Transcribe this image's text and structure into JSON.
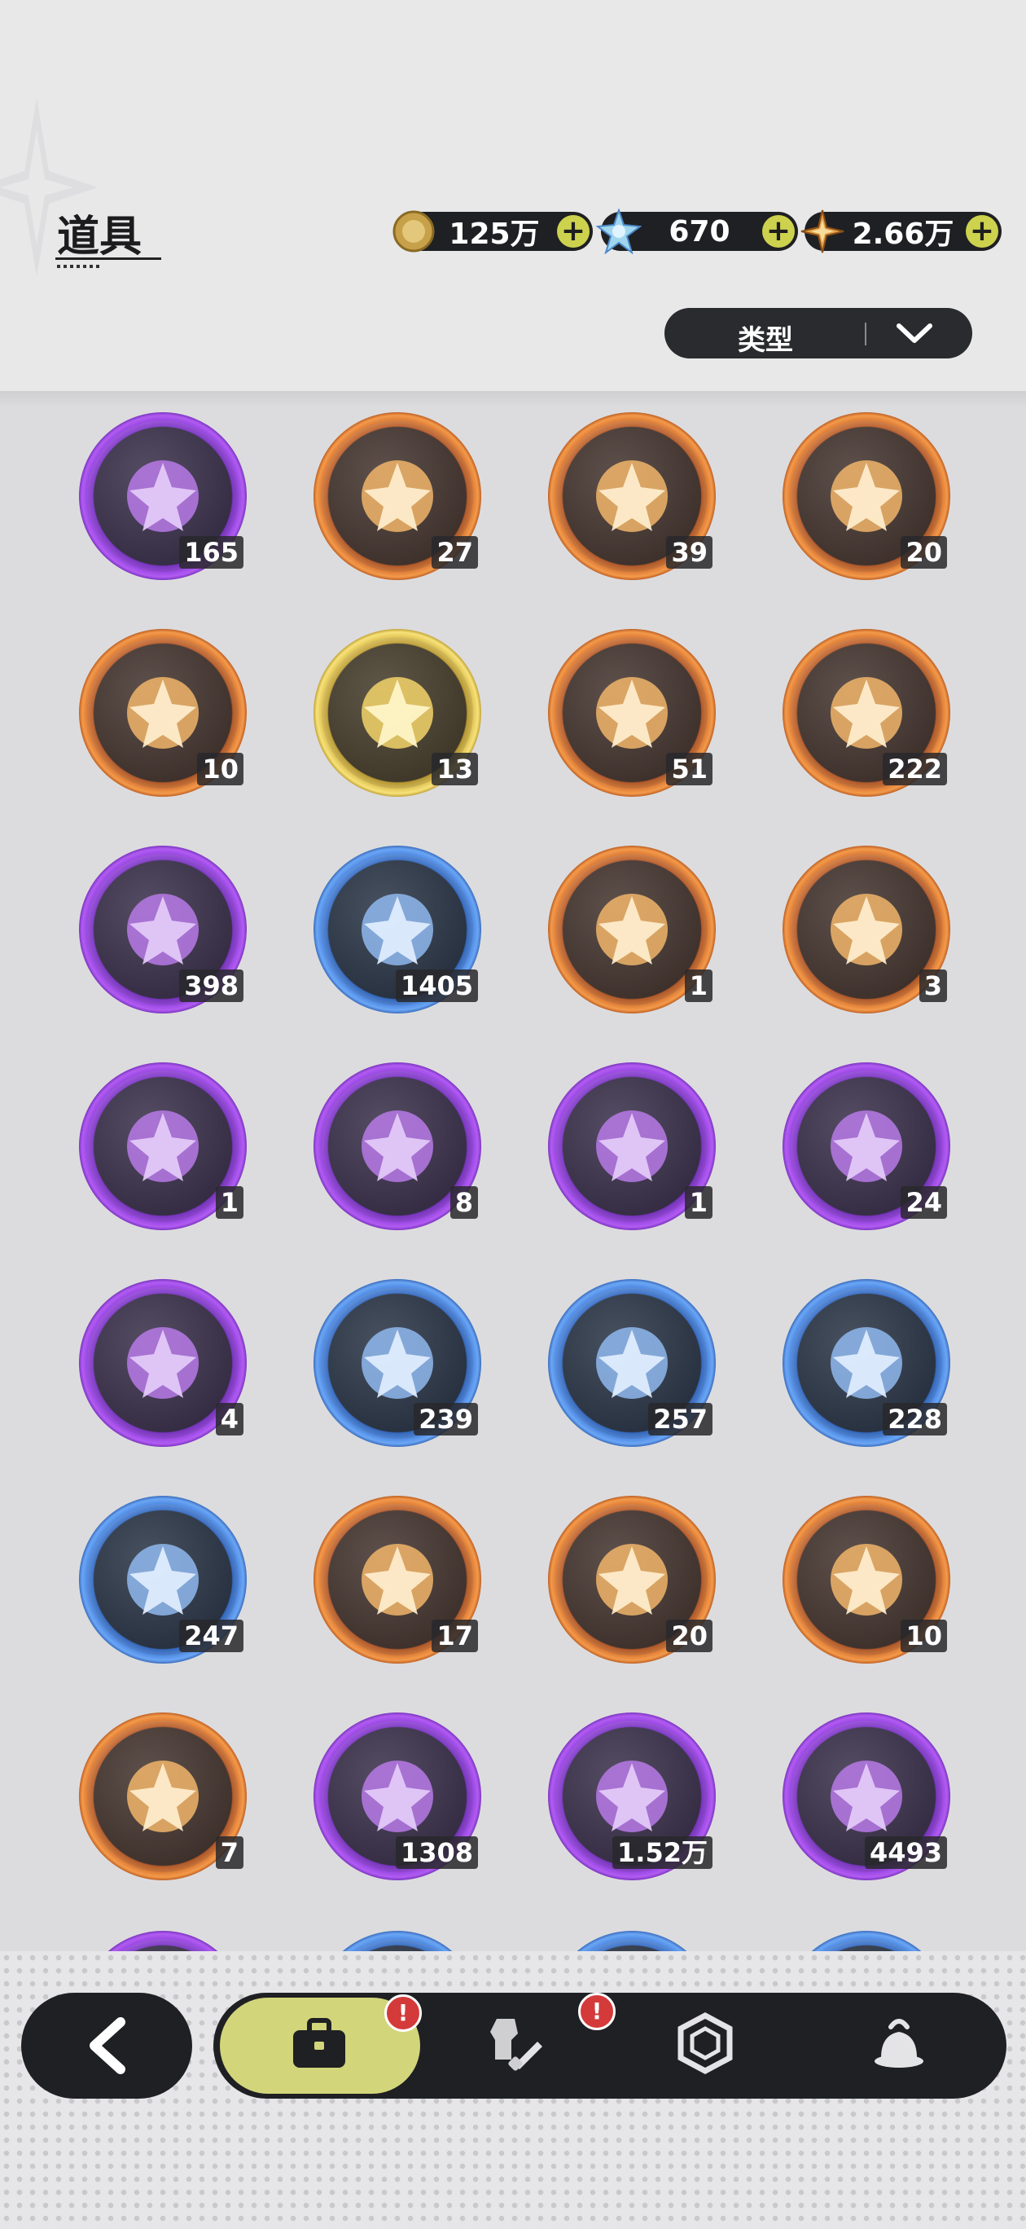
{
  "header": {
    "title": "道具"
  },
  "currencies": [
    {
      "name": "gold-coin",
      "value": "125万"
    },
    {
      "name": "crystal",
      "value": "670"
    },
    {
      "name": "star-shard",
      "value": "2.66万"
    }
  ],
  "filter": {
    "label": "类型"
  },
  "items": [
    {
      "icon": "plush-toy-fragment-icon",
      "count": "165",
      "rarity": "purple"
    },
    {
      "icon": "purple-star-crystal-icon",
      "count": "27",
      "rarity": "orange"
    },
    {
      "icon": "blue-star-crystal-icon",
      "count": "39",
      "rarity": "orange"
    },
    {
      "icon": "red-paw-charm-icon",
      "count": "20",
      "rarity": "orange"
    },
    {
      "icon": "gold-paw-charm-icon",
      "count": "10",
      "rarity": "orange"
    },
    {
      "icon": "gold-card-icon",
      "count": "13",
      "rarity": "gold"
    },
    {
      "icon": "rainbow-card-icon",
      "count": "51",
      "rarity": "orange"
    },
    {
      "icon": "bronze-card-icon",
      "count": "222",
      "rarity": "orange"
    },
    {
      "icon": "purple-card-icon",
      "count": "398",
      "rarity": "purple"
    },
    {
      "icon": "blue-card-icon",
      "count": "1405",
      "rarity": "blue"
    },
    {
      "icon": "refresh-card-icon",
      "count": "1",
      "rarity": "orange"
    },
    {
      "icon": "clover-card-icon",
      "count": "3",
      "rarity": "orange"
    },
    {
      "icon": "gift-box-icon",
      "count": "1",
      "rarity": "purple"
    },
    {
      "icon": "golden-pouch-icon",
      "count": "8",
      "rarity": "purple"
    },
    {
      "icon": "magic-mirror-icon",
      "count": "1",
      "rarity": "purple"
    },
    {
      "icon": "scroll-icon",
      "count": "24",
      "rarity": "purple"
    },
    {
      "icon": "pink-apple-icon",
      "count": "4",
      "rarity": "purple"
    },
    {
      "icon": "shovel-icon",
      "count": "239",
      "rarity": "blue"
    },
    {
      "icon": "boxing-glove-icon",
      "count": "257",
      "rarity": "blue"
    },
    {
      "icon": "pickaxe-icon",
      "count": "228",
      "rarity": "blue"
    },
    {
      "icon": "hammer-icon",
      "count": "247",
      "rarity": "blue"
    },
    {
      "icon": "ruby-heart-icon",
      "count": "17",
      "rarity": "orange"
    },
    {
      "icon": "shirt-token-icon",
      "count": "20",
      "rarity": "orange"
    },
    {
      "icon": "prize-wheel-ticket-icon",
      "count": "10",
      "rarity": "orange"
    },
    {
      "icon": "rainbow-ticket-icon",
      "count": "7",
      "rarity": "orange"
    },
    {
      "icon": "gold-ingot-icon",
      "count": "1308",
      "rarity": "purple"
    },
    {
      "icon": "fist-token-icon",
      "count": "1.52万",
      "rarity": "purple"
    },
    {
      "icon": "silver-coin-icon",
      "count": "4493",
      "rarity": "purple"
    }
  ],
  "peek_items": [
    {
      "rarity": "purple"
    },
    {
      "rarity": "blue"
    },
    {
      "rarity": "blue"
    },
    {
      "rarity": "blue"
    }
  ],
  "navbar": {
    "tabs": [
      {
        "icon": "briefcase-icon",
        "active": true,
        "badge": "!"
      },
      {
        "icon": "armor-sword-icon",
        "active": false,
        "badge": "!"
      },
      {
        "icon": "hexagon-gem-icon",
        "active": false
      },
      {
        "icon": "pudding-icon",
        "active": false
      }
    ]
  },
  "colors": {
    "purple": "#8a3bd8",
    "orange": "#d7702c",
    "blue": "#3b7ad8",
    "gold": "#dbbd3e",
    "accent": "#d2d57a",
    "badge": "#d43a3a"
  }
}
